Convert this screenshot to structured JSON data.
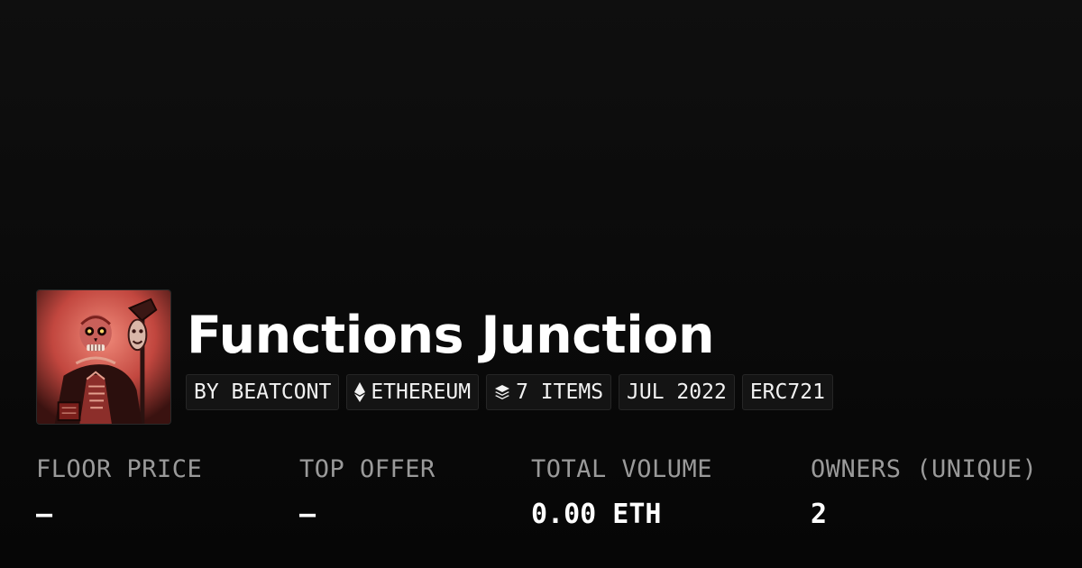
{
  "collection": {
    "title": "Functions Junction",
    "thumbnail_icon": "skeleton-artwork"
  },
  "badges": {
    "creator": "BY BEATCONT",
    "chain": {
      "icon": "ethereum-icon",
      "label": "ETHEREUM"
    },
    "items": {
      "icon": "layers-icon",
      "label": "7 ITEMS"
    },
    "date": "JUL 2022",
    "standard": "ERC721"
  },
  "stats": {
    "floor_price": {
      "label": "FLOOR PRICE",
      "value": "–"
    },
    "top_offer": {
      "label": "TOP OFFER",
      "value": "–"
    },
    "total_volume": {
      "label": "TOTAL VOLUME",
      "value": "0.00 ETH"
    },
    "owners": {
      "label": "OWNERS (UNIQUE)",
      "value": "2"
    }
  },
  "colors": {
    "background": "#0b0b0b",
    "text_primary": "#ffffff",
    "text_muted": "#9a9a9a",
    "badge_background": "#141414",
    "badge_border": "#262626"
  }
}
